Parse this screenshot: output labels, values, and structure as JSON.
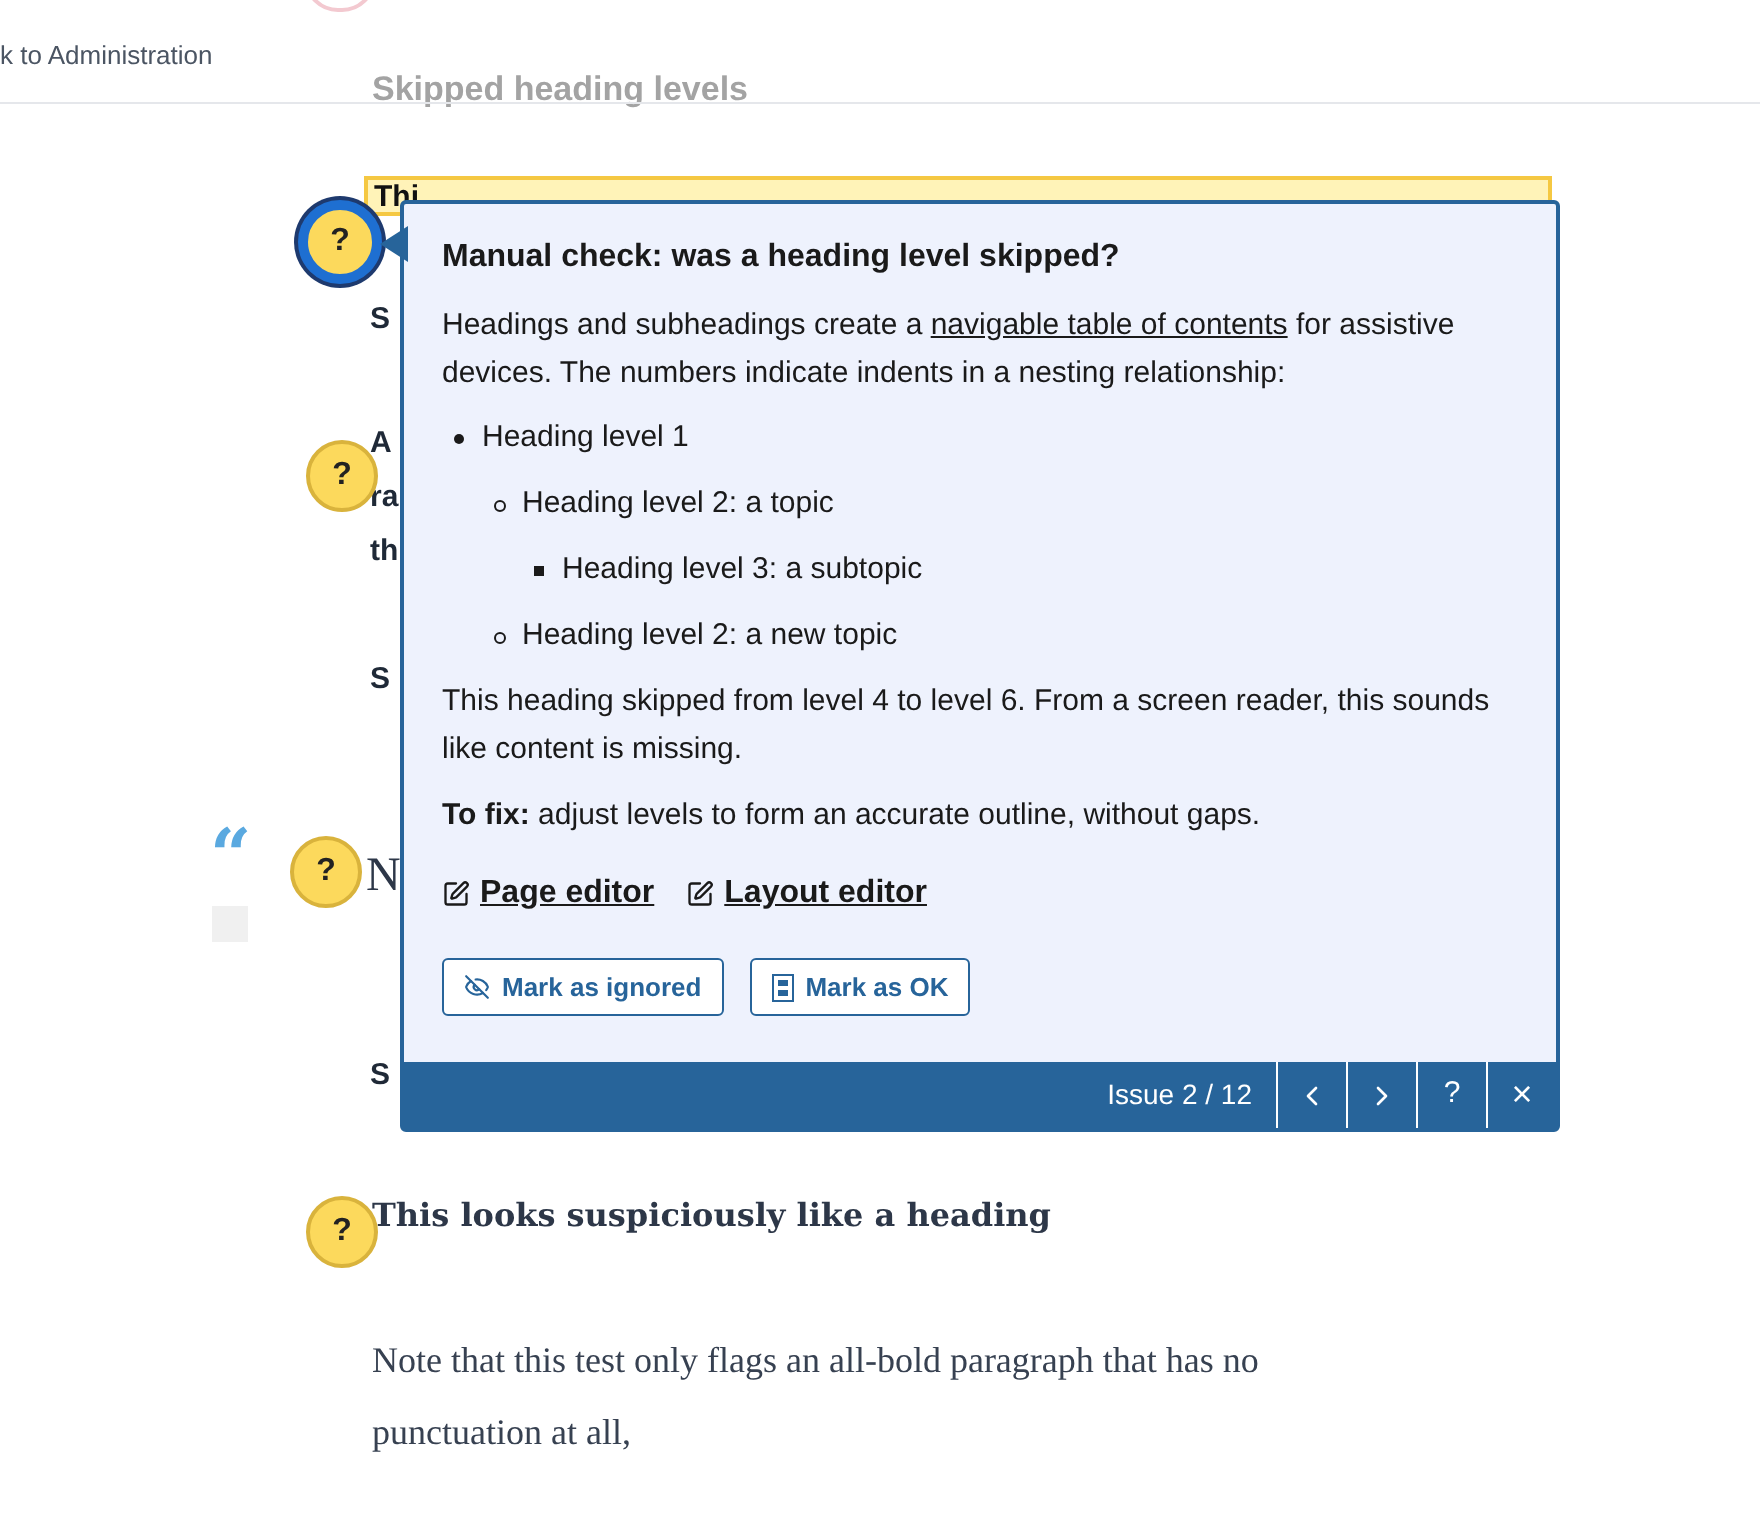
{
  "header": {
    "back_link": "k to Administration",
    "title": "Skipped heading levels"
  },
  "content": {
    "highlighted_heading": "Thi",
    "fragments": [
      {
        "kind": "sans",
        "text": "S"
      },
      {
        "kind": "sans",
        "text": "A"
      },
      {
        "kind": "sans",
        "text": "ra"
      },
      {
        "kind": "sans",
        "text": "th"
      },
      {
        "kind": "sans",
        "text": "S"
      },
      {
        "kind": "quote",
        "text": "“"
      },
      {
        "kind": "large",
        "text": "N"
      },
      {
        "kind": "sans",
        "text": "S"
      }
    ],
    "suspicious_heading": "This looks suspiciously like a heading",
    "paragraph": "Note that this test only flags an all-bold paragraph that has no punctuation at all,"
  },
  "markers": [
    {
      "label": "?",
      "selected": true
    },
    {
      "label": "?",
      "selected": false
    },
    {
      "label": "?",
      "selected": false
    },
    {
      "label": "?",
      "selected": false
    }
  ],
  "popup": {
    "title": "Manual check: was a heading level skipped?",
    "intro": {
      "before": "Headings and subheadings create a ",
      "link": "navigable table of contents",
      "after": " for assistive devices. The numbers indicate indents in a nesting relationship:"
    },
    "outline": [
      {
        "text": "Heading level 1",
        "children": [
          {
            "text": "Heading level 2: a topic",
            "children": [
              {
                "text": "Heading level 3: a subtopic"
              }
            ]
          },
          {
            "text": "Heading level 2: a new topic"
          }
        ]
      }
    ],
    "message": "This heading skipped from level 4 to level 6. From a screen reader, this sounds like content is missing.",
    "fix": "**To fix:** adjust levels to form an accurate outline, without gaps.",
    "editor_links": [
      "Page editor",
      "Layout editor"
    ],
    "actions": [
      {
        "kind": "ignore",
        "label": "Mark as ignored"
      },
      {
        "kind": "ok",
        "label": "Mark as OK"
      }
    ],
    "footer": {
      "counter": "Issue 2 / 12",
      "help": "?",
      "close": "×"
    }
  }
}
